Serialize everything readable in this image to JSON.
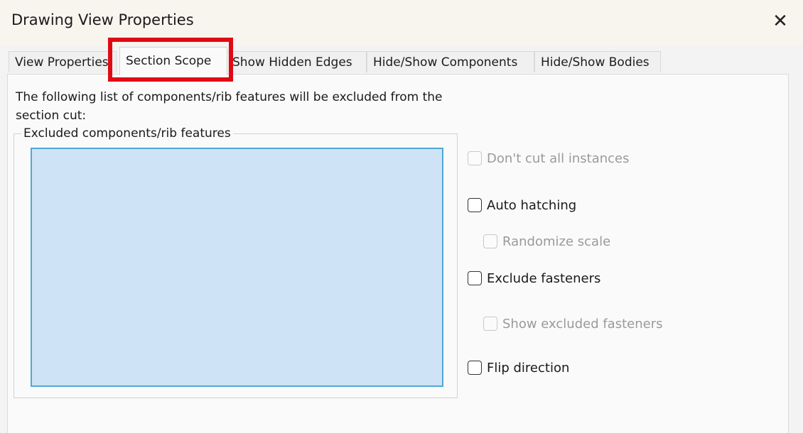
{
  "window": {
    "title": "Drawing View Properties",
    "close_glyph": "✕"
  },
  "tabs": [
    {
      "label": "View Properties",
      "active": false
    },
    {
      "label": "Section Scope",
      "active": true
    },
    {
      "label": "Show Hidden Edges",
      "active": false
    },
    {
      "label": "Hide/Show Components",
      "active": false
    },
    {
      "label": "Hide/Show Bodies",
      "active": false
    }
  ],
  "section_scope": {
    "description": "The following list of components/rib features will be excluded from the section cut:",
    "group_label": "Excluded components/rib features",
    "excluded_items": []
  },
  "options": {
    "dont_cut_all_instances": {
      "label": "Don't cut all instances",
      "checked": false,
      "enabled": false
    },
    "auto_hatching": {
      "label": "Auto hatching",
      "checked": false,
      "enabled": true
    },
    "randomize_scale": {
      "label": "Randomize scale",
      "checked": false,
      "enabled": false
    },
    "exclude_fasteners": {
      "label": "Exclude fasteners",
      "checked": false,
      "enabled": true
    },
    "show_excluded_fasteners": {
      "label": "Show excluded fasteners",
      "checked": false,
      "enabled": false
    },
    "flip_direction": {
      "label": "Flip direction",
      "checked": false,
      "enabled": true
    }
  },
  "colors": {
    "highlight": "#e00a14",
    "listbox_fill": "#cfe3f6",
    "listbox_border": "#4ea9d6"
  },
  "icons": {
    "close": "close-icon"
  }
}
